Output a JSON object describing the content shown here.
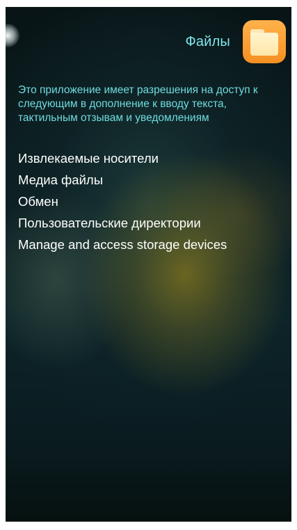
{
  "header": {
    "app_name": "Файлы",
    "icon": "folder-icon",
    "icon_colors": {
      "tile": "#f7951f",
      "folder": "#ffeeb8"
    }
  },
  "description": "Это приложение имеет разрешения на доступ к следующим в дополнение к вводу текста, тактильным отзывам и уведомлениям",
  "permissions": [
    "Извлекаемые носители",
    "Медиа файлы",
    "Обмен",
    "Пользовательские директории",
    "Manage and access storage devices"
  ],
  "colors": {
    "accent_text": "#7fe6ea",
    "primary_text": "#ffffff",
    "background": "#0b1d20"
  }
}
